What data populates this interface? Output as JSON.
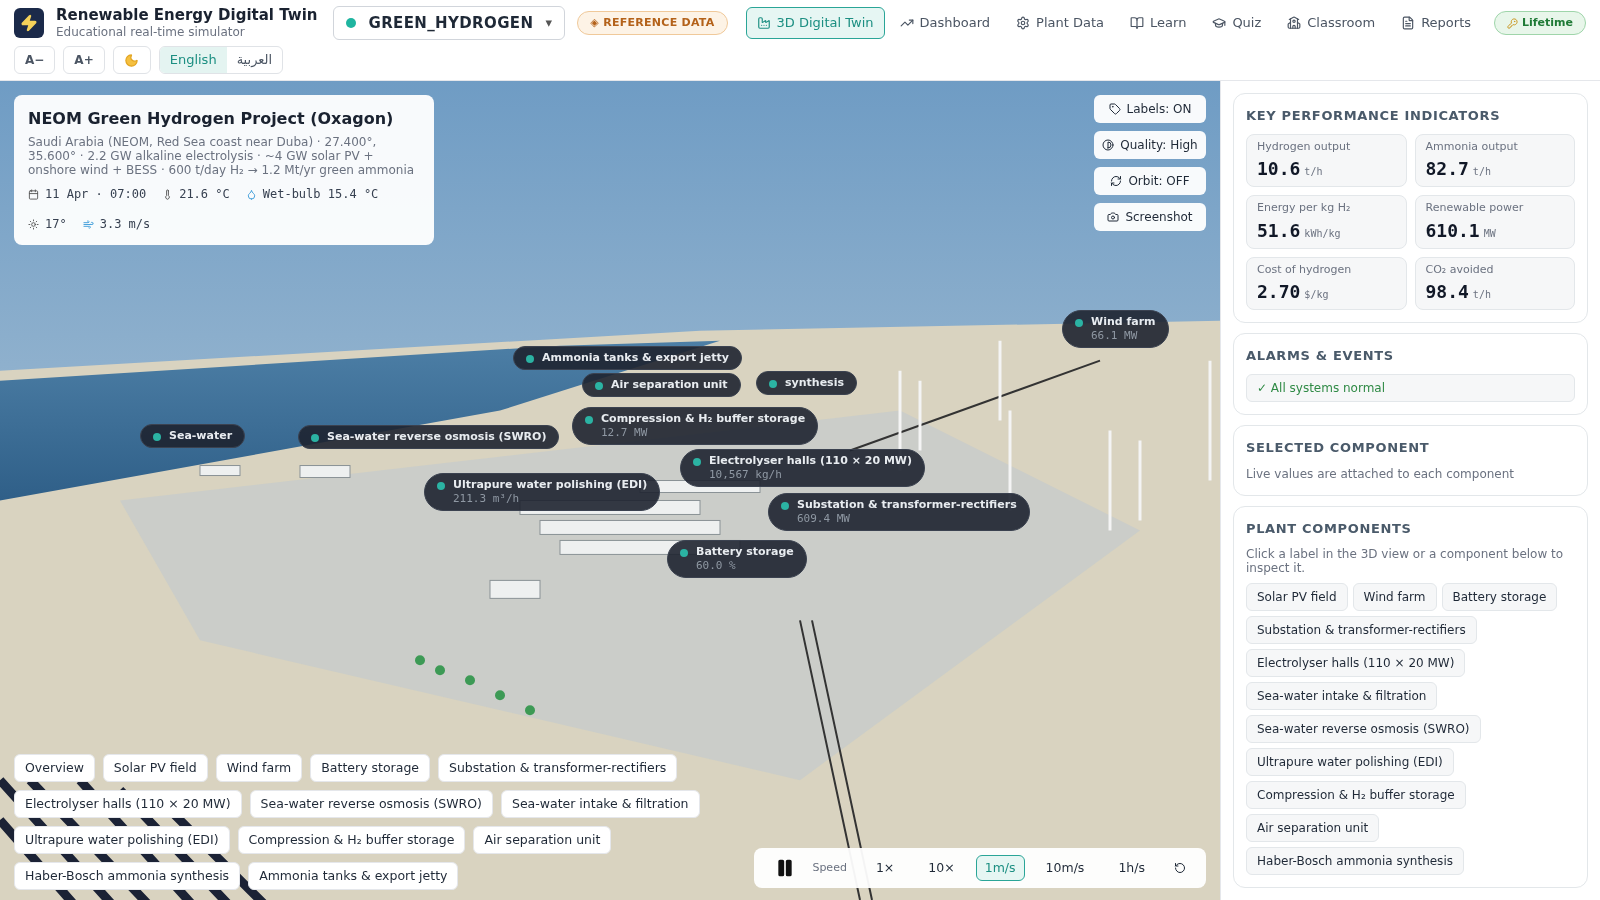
{
  "app": {
    "title": "Renewable Energy Digital Twin",
    "subtitle": "Educational real-time simulator"
  },
  "scenario": {
    "value": "GREEN_HYDROGEN",
    "caret": "▾"
  },
  "data_badge": "◈ REFERENCE DATA",
  "nav": [
    {
      "label": "3D Digital Twin",
      "selected": true
    },
    {
      "label": "Dashboard",
      "selected": false
    },
    {
      "label": "Plant Data",
      "selected": false
    },
    {
      "label": "Learn",
      "selected": false
    },
    {
      "label": "Quiz",
      "selected": false
    },
    {
      "label": "Classroom",
      "selected": false
    },
    {
      "label": "Reports",
      "selected": false
    }
  ],
  "plan_badge": "Lifetime",
  "font_buttons": [
    "A−",
    "A+"
  ],
  "languages": [
    {
      "label": "English",
      "selected": true
    },
    {
      "label": "العربية",
      "selected": false
    }
  ],
  "info": {
    "title": "NEOM Green Hydrogen Project (Oxagon)",
    "description": "Saudi Arabia (NEOM, Red Sea coast near Duba) · 27.400°, 35.600° · 2.2 GW alkaline electrolysis · ~4 GW solar PV + onshore wind + BESS · 600 t/day H₂ → 1.2 Mt/yr green ammonia",
    "conditions": [
      {
        "kind": "date",
        "text": "11 Apr · 07:00"
      },
      {
        "kind": "temp",
        "text": "21.6 °C"
      },
      {
        "kind": "wetbulb",
        "text": "Wet-bulb 15.4 °C"
      },
      {
        "kind": "sun",
        "text": "17°"
      },
      {
        "kind": "wind",
        "text": "3.3 m/s"
      }
    ]
  },
  "view_buttons": [
    {
      "kind": "labels",
      "label": "Labels: ON"
    },
    {
      "kind": "quality",
      "label": "Quality: High"
    },
    {
      "kind": "orbit",
      "label": "Orbit: OFF"
    },
    {
      "kind": "screenshot",
      "label": "Screenshot"
    }
  ],
  "scene_labels": [
    {
      "name": "Wind farm",
      "value": "66.1 MW"
    },
    {
      "name": "Ammonia tanks & export jetty"
    },
    {
      "name": "synthesis"
    },
    {
      "name": "Air separation unit"
    },
    {
      "name": "Sea-water"
    },
    {
      "name": "Sea-water reverse osmosis (SWRO)"
    },
    {
      "name": "Compression & H₂ buffer storage",
      "value": "12.7 MW"
    },
    {
      "name": "Electrolyser halls (110 × 20 MW)",
      "value": "10,567 kg/h"
    },
    {
      "name": "Ultrapure water polishing (EDI)",
      "value": "211.3 m³/h"
    },
    {
      "name": "Substation & transformer-rectifiers",
      "value": "609.4 MW"
    },
    {
      "name": "Battery storage",
      "value": "60.0 %"
    }
  ],
  "camera_views": [
    "Overview",
    "Solar PV field",
    "Wind farm",
    "Battery storage",
    "Substation & transformer-rectifiers",
    "Electrolyser halls (110 × 20 MW)",
    "Sea-water reverse osmosis (SWRO)",
    "Sea-water intake & filtration",
    "Ultrapure water polishing (EDI)",
    "Compression & H₂ buffer storage",
    "Air separation unit",
    "Haber-Bosch ammonia synthesis",
    "Ammonia tanks & export jetty"
  ],
  "speed": {
    "label": "Speed",
    "options": [
      {
        "label": "1×",
        "selected": false
      },
      {
        "label": "10×",
        "selected": false
      },
      {
        "label": "1m/s",
        "selected": true
      },
      {
        "label": "10m/s",
        "selected": false
      },
      {
        "label": "1h/s",
        "selected": false
      }
    ]
  },
  "kpi": {
    "title": "KEY PERFORMANCE INDICATORS",
    "items": [
      {
        "label": "Hydrogen output",
        "value": "10.6",
        "unit": "t/h"
      },
      {
        "label": "Ammonia output",
        "value": "82.7",
        "unit": "t/h"
      },
      {
        "label": "Energy per kg H₂",
        "value": "51.6",
        "unit": "kWh/kg"
      },
      {
        "label": "Renewable power",
        "value": "610.1",
        "unit": "MW"
      },
      {
        "label": "Cost of hydrogen",
        "value": "2.70",
        "unit": "$/kg"
      },
      {
        "label": "CO₂ avoided",
        "value": "98.4",
        "unit": "t/h"
      }
    ]
  },
  "alarms": {
    "title": "ALARMS & EVENTS",
    "status": "✓ All systems normal"
  },
  "selected_component": {
    "title": "SELECTED COMPONENT",
    "text": "Live values are attached to each component"
  },
  "components": {
    "title": "PLANT COMPONENTS",
    "hint": "Click a label in the 3D view or a component below to inspect it.",
    "items": [
      "Solar PV field",
      "Wind farm",
      "Battery storage",
      "Substation & transformer-rectifiers",
      "Electrolyser halls (110 × 20 MW)",
      "Sea-water intake & filtration",
      "Sea-water reverse osmosis (SWRO)",
      "Ultrapure water polishing (EDI)",
      "Compression & H₂ buffer storage",
      "Air separation unit",
      "Haber-Bosch ammonia synthesis"
    ]
  }
}
